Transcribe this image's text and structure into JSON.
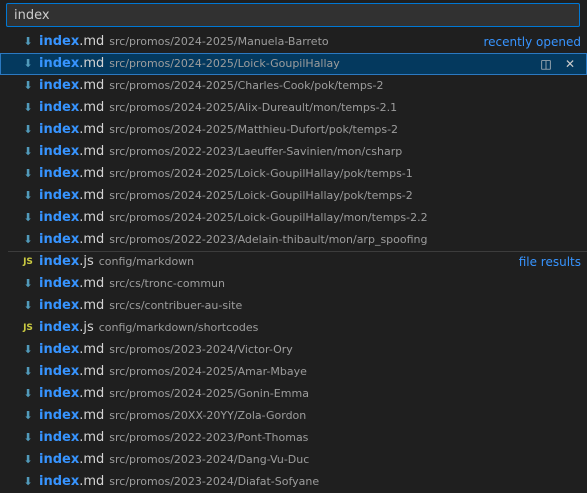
{
  "search": {
    "value": "index"
  },
  "groups": [
    {
      "label": "recently opened",
      "items": [
        {
          "icon": "markdown-icon",
          "name": "index",
          "ext": ".md",
          "path": "src/promos/2024-2025/Manuela-Barreto",
          "selected": false
        },
        {
          "icon": "markdown-icon",
          "name": "index",
          "ext": ".md",
          "path": "src/promos/2024-2025/Loick-GoupilHallay",
          "selected": true
        },
        {
          "icon": "markdown-icon",
          "name": "index",
          "ext": ".md",
          "path": "src/promos/2024-2025/Charles-Cook/pok/temps-2",
          "selected": false
        },
        {
          "icon": "markdown-icon",
          "name": "index",
          "ext": ".md",
          "path": "src/promos/2024-2025/Alix-Dureault/mon/temps-2.1",
          "selected": false
        },
        {
          "icon": "markdown-icon",
          "name": "index",
          "ext": ".md",
          "path": "src/promos/2024-2025/Matthieu-Dufort/pok/temps-2",
          "selected": false
        },
        {
          "icon": "markdown-icon",
          "name": "index",
          "ext": ".md",
          "path": "src/promos/2022-2023/Laeuffer-Savinien/mon/csharp",
          "selected": false
        },
        {
          "icon": "markdown-icon",
          "name": "index",
          "ext": ".md",
          "path": "src/promos/2024-2025/Loick-GoupilHallay/pok/temps-1",
          "selected": false
        },
        {
          "icon": "markdown-icon",
          "name": "index",
          "ext": ".md",
          "path": "src/promos/2024-2025/Loick-GoupilHallay/pok/temps-2",
          "selected": false
        },
        {
          "icon": "markdown-icon",
          "name": "index",
          "ext": ".md",
          "path": "src/promos/2024-2025/Loick-GoupilHallay/mon/temps-2.2",
          "selected": false
        },
        {
          "icon": "markdown-icon",
          "name": "index",
          "ext": ".md",
          "path": "src/promos/2022-2023/Adelain-thibault/mon/arp_spoofing",
          "selected": false
        }
      ]
    },
    {
      "label": "file results",
      "items": [
        {
          "icon": "javascript-icon",
          "name": "index",
          "ext": ".js",
          "path": "config/markdown",
          "selected": false
        },
        {
          "icon": "markdown-icon",
          "name": "index",
          "ext": ".md",
          "path": "src/cs/tronc-commun",
          "selected": false
        },
        {
          "icon": "markdown-icon",
          "name": "index",
          "ext": ".md",
          "path": "src/cs/contribuer-au-site",
          "selected": false
        },
        {
          "icon": "javascript-icon",
          "name": "index",
          "ext": ".js",
          "path": "config/markdown/shortcodes",
          "selected": false
        },
        {
          "icon": "markdown-icon",
          "name": "index",
          "ext": ".md",
          "path": "src/promos/2023-2024/Victor-Ory",
          "selected": false
        },
        {
          "icon": "markdown-icon",
          "name": "index",
          "ext": ".md",
          "path": "src/promos/2024-2025/Amar-Mbaye",
          "selected": false
        },
        {
          "icon": "markdown-icon",
          "name": "index",
          "ext": ".md",
          "path": "src/promos/2024-2025/Gonin-Emma",
          "selected": false
        },
        {
          "icon": "markdown-icon",
          "name": "index",
          "ext": ".md",
          "path": "src/promos/20XX-20YY/Zola-Gordon",
          "selected": false
        },
        {
          "icon": "markdown-icon",
          "name": "index",
          "ext": ".md",
          "path": "src/promos/2022-2023/Pont-Thomas",
          "selected": false
        },
        {
          "icon": "markdown-icon",
          "name": "index",
          "ext": ".md",
          "path": "src/promos/2023-2024/Dang-Vu-Duc",
          "selected": false
        },
        {
          "icon": "markdown-icon",
          "name": "index",
          "ext": ".md",
          "path": "src/promos/2023-2024/Diafat-Sofyane",
          "selected": false
        }
      ]
    }
  ],
  "row_actions": {
    "open_to_side_icon": "split-editor-icon",
    "remove_icon": "close-icon"
  }
}
